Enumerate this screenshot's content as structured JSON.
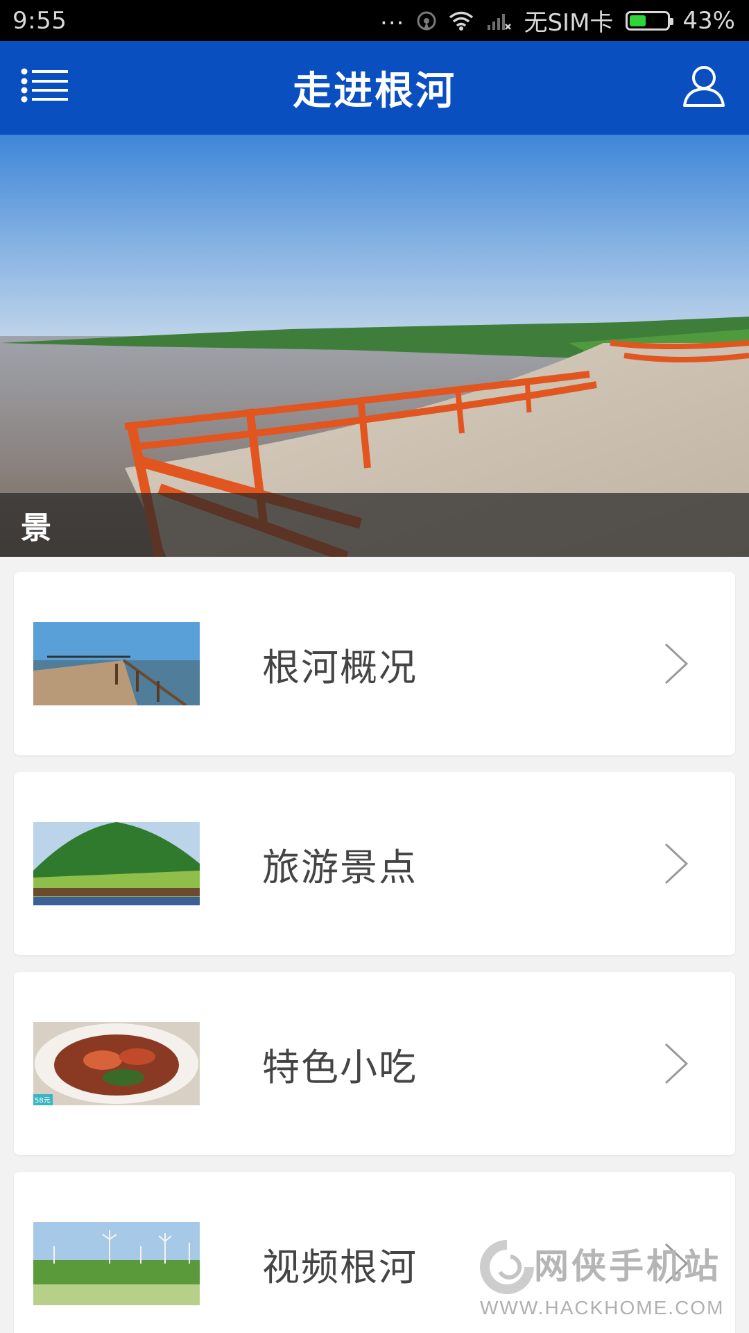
{
  "status_bar": {
    "time": "9:55",
    "dots": "...",
    "carrier": "无SIM卡",
    "battery_percent_text": "43%",
    "battery_level": 0.43
  },
  "header": {
    "title": "走进根河",
    "menu_icon": "list-menu-icon",
    "user_icon": "user-profile-icon"
  },
  "banner": {
    "caption": "景"
  },
  "menu_items": [
    {
      "label": "根河概况",
      "thumb": "pier-lake-photo"
    },
    {
      "label": "旅游景点",
      "thumb": "grassland-horses-photo"
    },
    {
      "label": "特色小吃",
      "thumb": "shrimp-dish-photo"
    },
    {
      "label": "视频根河",
      "thumb": "wind-turbines-photo"
    }
  ],
  "food_thumb_badge": "58元",
  "watermark": {
    "name": "网侠手机站",
    "url": "WWW.HACKHOME.COM"
  },
  "colors": {
    "header_bg": "#0a4fbf",
    "page_bg": "#f2f2f2"
  }
}
